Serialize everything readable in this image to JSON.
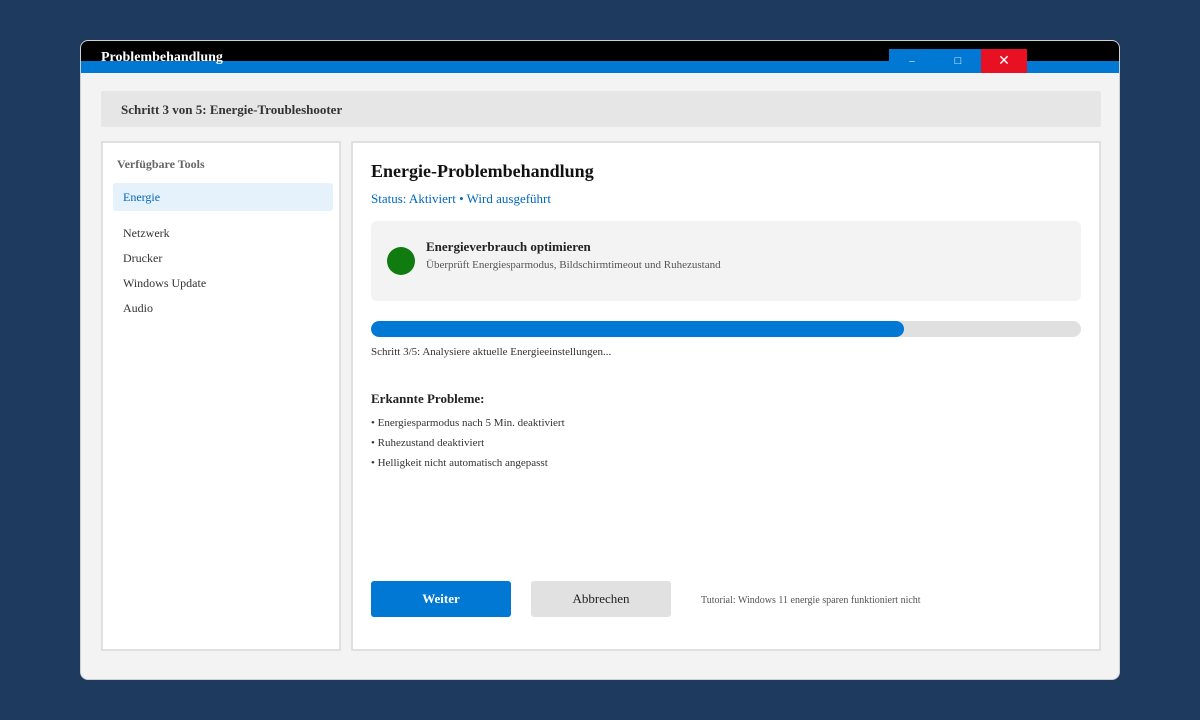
{
  "window": {
    "title": "Problembehandlung",
    "minimize_glyph": "–",
    "maximize_glyph": "□",
    "close_glyph": "✕"
  },
  "breadcrumb": "Schritt 3 von 5: Energie-Troubleshooter",
  "sidebar": {
    "title": "Verfügbare Tools",
    "items": [
      {
        "label": "Energie",
        "active": true
      },
      {
        "label": "Netzwerk"
      },
      {
        "label": "Drucker"
      },
      {
        "label": "Windows Update"
      },
      {
        "label": "Audio"
      }
    ]
  },
  "main": {
    "title": "Energie-Problembehandlung",
    "status": "Status: Aktiviert • Wird ausgeführt",
    "card": {
      "title": "Energieverbrauch optimieren",
      "subtitle": "Überprüft Energiesparmodus, Bildschirmtimeout und Ruhezustand",
      "status_color": "#107c10"
    },
    "progress": {
      "fraction": 0.75,
      "text": "Schritt 3/5: Analysiere aktuelle Energieeinstellungen..."
    },
    "issues": {
      "title": "Erkannte Probleme:",
      "items": [
        "• Energiesparmodus nach 5 Min. deaktiviert",
        "• Ruhezustand deaktiviert",
        "• Helligkeit nicht automatisch angepasst"
      ]
    },
    "buttons": {
      "next": "Weiter",
      "cancel": "Abbrechen"
    },
    "tutorial": "Tutorial: Windows 11 energie sparen funktioniert nicht"
  },
  "colors": {
    "accent": "#0078d4",
    "close": "#e81123",
    "success": "#107c10",
    "desktop": "#1e3a5f"
  }
}
